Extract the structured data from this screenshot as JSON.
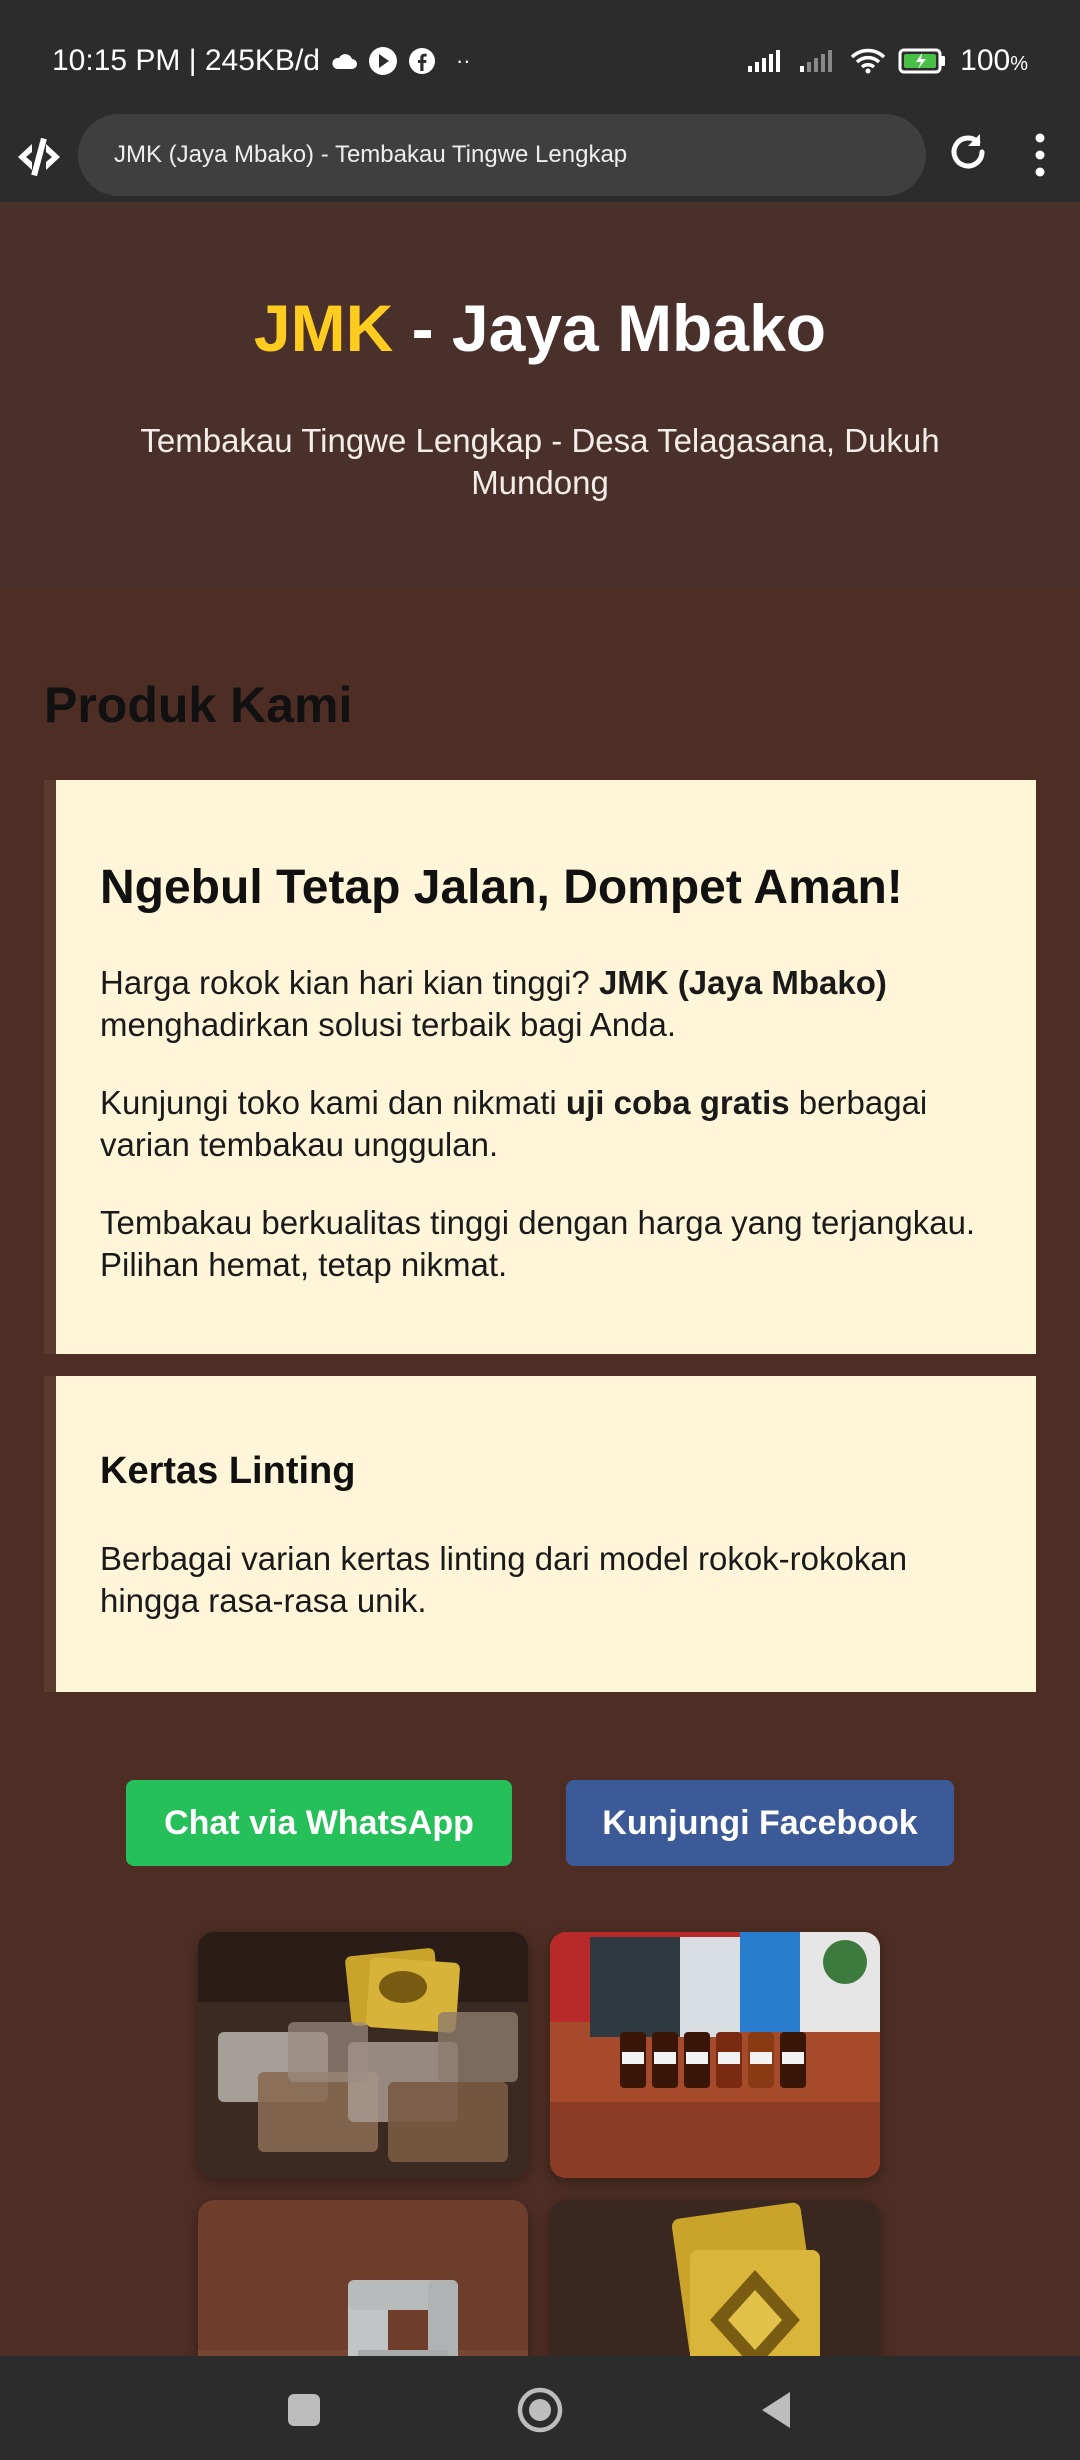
{
  "status_bar": {
    "time_info": "10:15 PM | 245KB/d",
    "more": "··",
    "battery": "100"
  },
  "browser": {
    "url_title": "JMK (Jaya Mbako) - Tembakau Tingwe Lengkap"
  },
  "hero": {
    "brand": "JMK",
    "title_rest": " - Jaya Mbako",
    "subtitle": "Tembakau Tingwe Lengkap - Desa Telagasana, Dukuh Mundong"
  },
  "products": {
    "section_title": "Produk Kami",
    "card1": {
      "title": "Ngebul Tetap Jalan, Dompet Aman!",
      "p1_pre": "Harga rokok kian hari kian tinggi? ",
      "p1_bold": "JMK (Jaya Mbako)",
      "p1_post": " menghadirkan solusi terbaik bagi Anda.",
      "p2_pre": "Kunjungi toko kami dan nikmati ",
      "p2_bold": "uji coba gratis",
      "p2_post": " berbagai varian tembakau unggulan.",
      "p3": "Tembakau berkualitas tinggi dengan harga yang terjangkau. Pilihan hemat, tetap nikmat."
    },
    "card2": {
      "title": "Kertas Linting",
      "body": "Berbagai varian kertas linting dari model rokok-rokokan hingga rasa-rasa unik."
    }
  },
  "buttons": {
    "whatsapp": "Chat via WhatsApp",
    "facebook": "Kunjungi Facebook"
  },
  "colors": {
    "accent": "#ffcc1f",
    "whatsapp": "#25c05a",
    "facebook": "#3d5a98",
    "page_bg": "#4e2e24",
    "card_bg": "#fff6d9"
  },
  "icons": [
    "cloud-icon",
    "play-icon",
    "facebook-icon",
    "signal-icon",
    "wifi-icon",
    "battery-icon",
    "site-logo-icon",
    "reload-icon",
    "menu-icon",
    "home-icon",
    "back-icon",
    "recents-icon"
  ]
}
